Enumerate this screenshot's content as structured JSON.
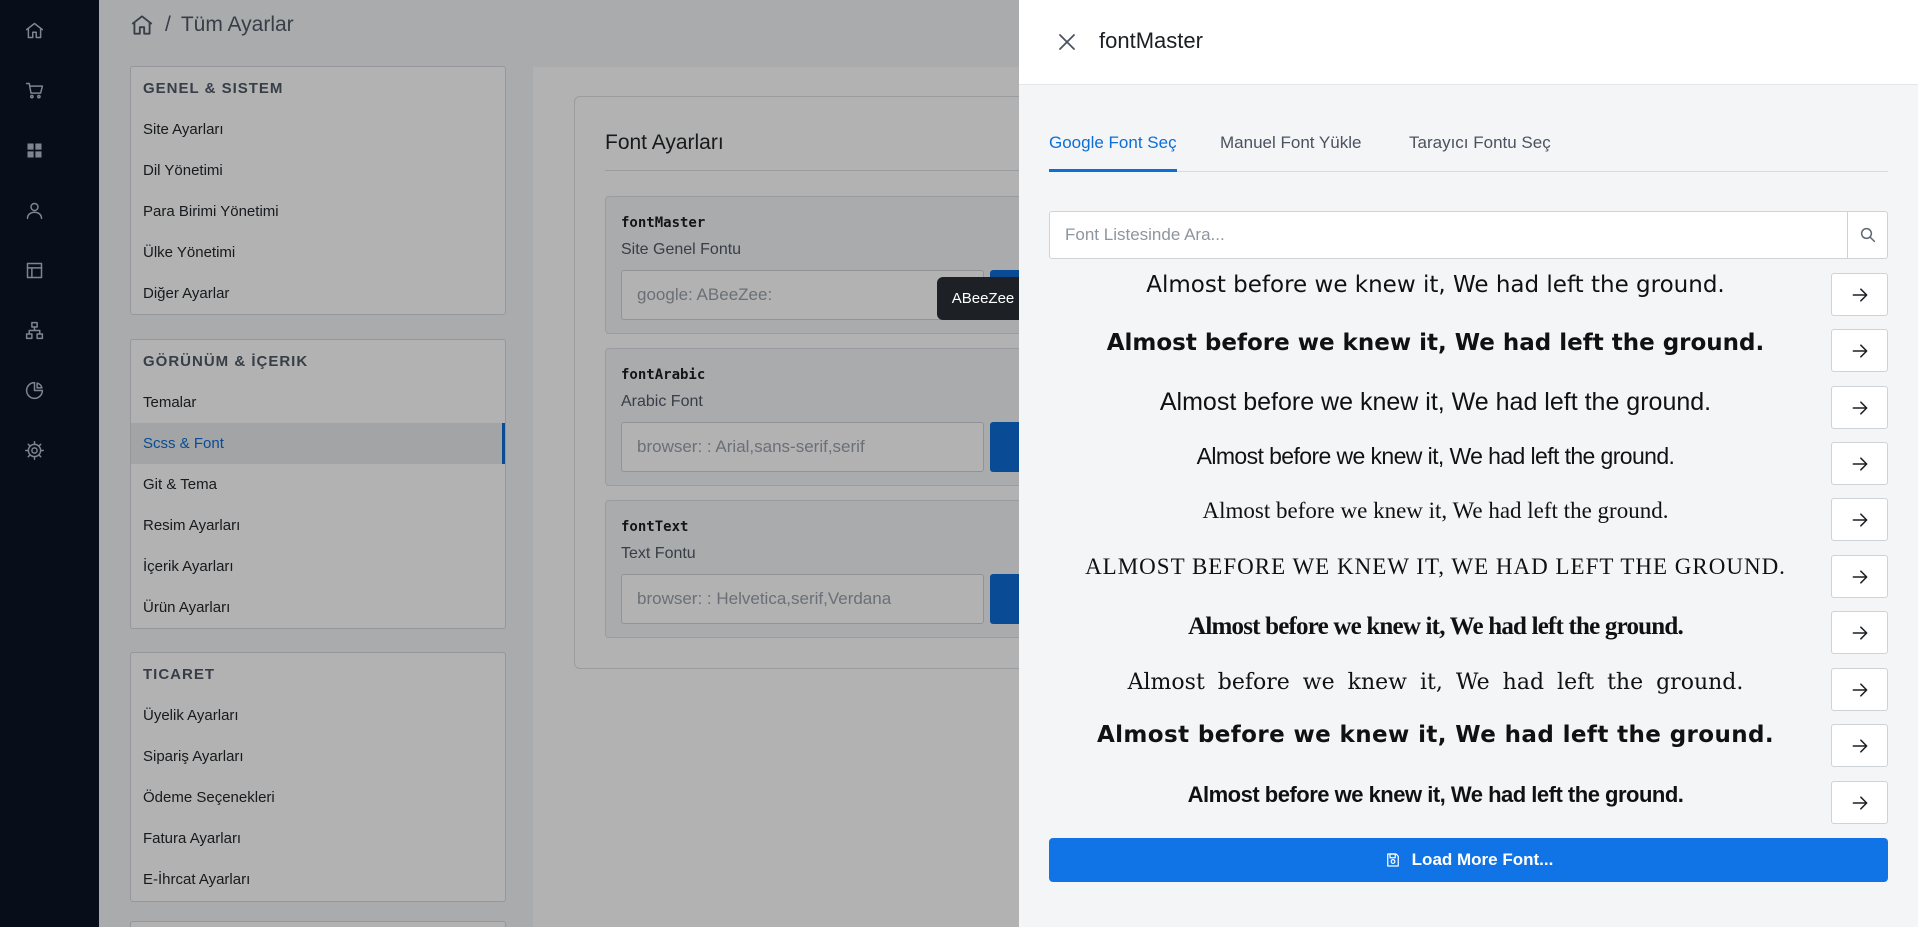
{
  "breadcrumb": {
    "separator": "/",
    "current": "Tüm Ayarlar"
  },
  "rail": {
    "icons": [
      "home-icon",
      "cart-icon",
      "grid-icon",
      "user-icon",
      "layout-icon",
      "sitemap-icon",
      "pie-chart-icon",
      "gear-icon"
    ]
  },
  "menu": {
    "groups": [
      {
        "title": "GENEL & SISTEM",
        "items": [
          "Site Ayarları",
          "Dil Yönetimi",
          "Para Birimi Yönetimi",
          "Ülke Yönetimi",
          "Diğer Ayarlar"
        ]
      },
      {
        "title": "GÖRÜNÜM & İÇERIK",
        "items": [
          "Temalar",
          "Scss & Font",
          "Git & Tema",
          "Resim Ayarları",
          "İçerik Ayarları",
          "Ürün Ayarları"
        ],
        "active": "Scss & Font"
      },
      {
        "title": "TICARET",
        "items": [
          "Üyelik Ayarları",
          "Sipariş Ayarları",
          "Ödeme Seçenekleri",
          "Fatura Ayarları",
          "E-İhrcat Ayarları"
        ]
      }
    ]
  },
  "font_settings": {
    "title": "Font Ayarları",
    "items": [
      {
        "key": "fontMaster",
        "desc": "Site Genel Fontu",
        "value": "google: ABeeZee:"
      },
      {
        "key": "fontArabic",
        "desc": "Arabic Font",
        "value": "browser: : Arial,sans-serif,serif"
      },
      {
        "key": "fontText",
        "desc": "Text Fontu",
        "value": "browser: : Helvetica,serif,Verdana"
      }
    ]
  },
  "tooltip": {
    "text": "ABeeZee"
  },
  "drawer": {
    "title": "fontMaster",
    "tabs": [
      {
        "label": "Google Font Seç",
        "active": true
      },
      {
        "label": "Manuel Font Yükle",
        "active": false
      },
      {
        "label": "Tarayıcı Fontu Seç",
        "active": false
      }
    ],
    "search": {
      "placeholder": "Font Listesinde Ara...",
      "value": ""
    },
    "sample_text": "Almost before we knew it, We had left the ground.",
    "sample_count": 10,
    "load_more_label": "Load More Font..."
  },
  "colors": {
    "accent": "#0d6ed6",
    "button": "#1174e6",
    "rail": "#0b1526",
    "tooltip": "#1d2126"
  }
}
